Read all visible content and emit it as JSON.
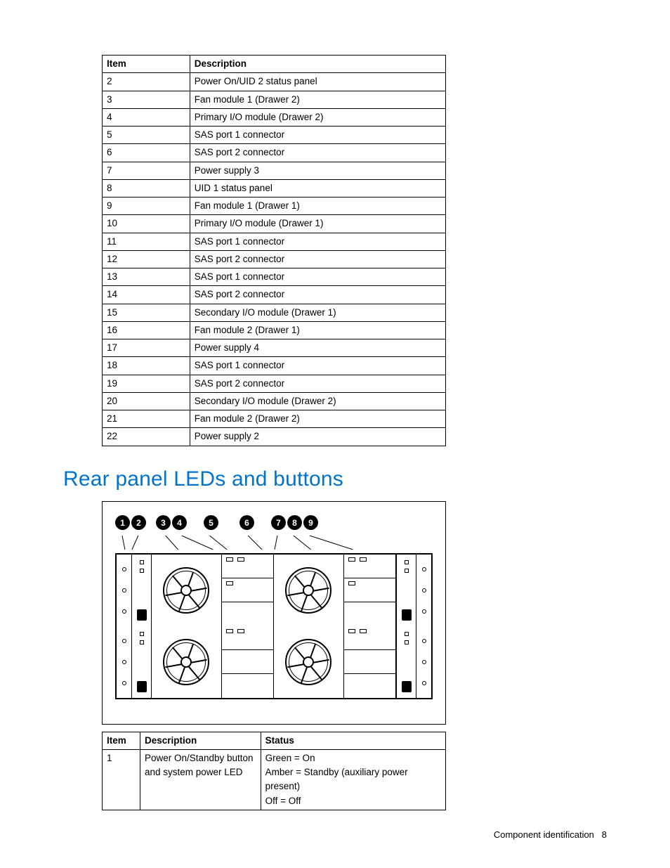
{
  "table1": {
    "headers": {
      "item": "Item",
      "description": "Description"
    },
    "rows": [
      {
        "item": "2",
        "description": "Power On/UID 2 status panel"
      },
      {
        "item": "3",
        "description": "Fan module 1 (Drawer 2)"
      },
      {
        "item": "4",
        "description": "Primary I/O module (Drawer 2)"
      },
      {
        "item": "5",
        "description": "SAS port 1 connector"
      },
      {
        "item": "6",
        "description": "SAS port 2 connector"
      },
      {
        "item": "7",
        "description": "Power supply 3"
      },
      {
        "item": "8",
        "description": "UID 1 status panel"
      },
      {
        "item": "9",
        "description": "Fan module 1 (Drawer 1)"
      },
      {
        "item": "10",
        "description": "Primary I/O module (Drawer 1)"
      },
      {
        "item": "11",
        "description": "SAS port 1 connector"
      },
      {
        "item": "12",
        "description": "SAS port 2 connector"
      },
      {
        "item": "13",
        "description": "SAS port 1 connector"
      },
      {
        "item": "14",
        "description": "SAS port 2 connector"
      },
      {
        "item": "15",
        "description": "Secondary I/O module (Drawer 1)"
      },
      {
        "item": "16",
        "description": "Fan module 2 (Drawer 1)"
      },
      {
        "item": "17",
        "description": "Power supply 4"
      },
      {
        "item": "18",
        "description": "SAS port 1 connector"
      },
      {
        "item": "19",
        "description": "SAS port 2 connector"
      },
      {
        "item": "20",
        "description": "Secondary I/O module (Drawer 2)"
      },
      {
        "item": "21",
        "description": "Fan module 2 (Drawer 2)"
      },
      {
        "item": "22",
        "description": "Power supply 2"
      }
    ]
  },
  "section_heading": "Rear panel LEDs and buttons",
  "diagram": {
    "callouts": [
      "1",
      "2",
      "3",
      "4",
      "5",
      "6",
      "7",
      "8",
      "9"
    ]
  },
  "table2": {
    "headers": {
      "item": "Item",
      "description": "Description",
      "status": "Status"
    },
    "rows": [
      {
        "item": "1",
        "description": "Power On/Standby button and system power LED",
        "status": "Green = On\nAmber = Standby (auxiliary power present)\nOff = Off"
      }
    ]
  },
  "footer": {
    "section": "Component identification",
    "page": "8"
  }
}
